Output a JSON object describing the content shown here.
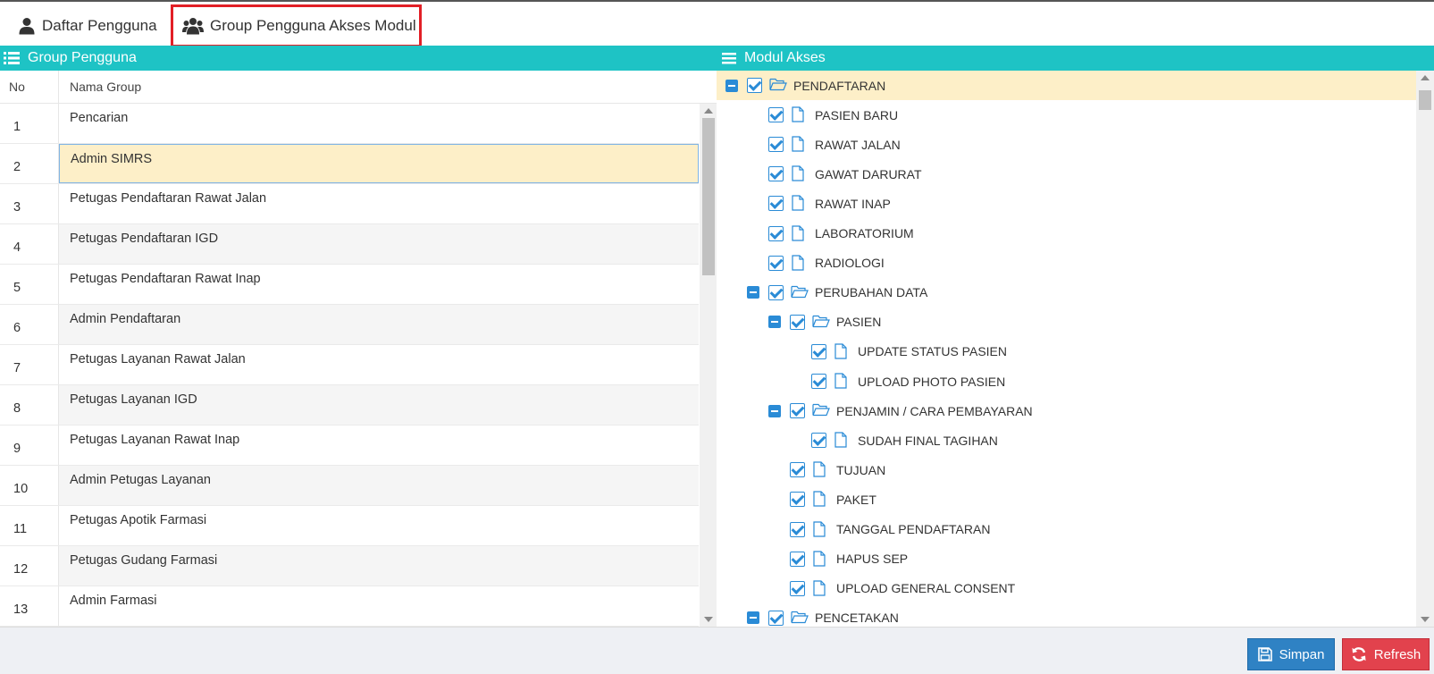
{
  "tabs": [
    {
      "label": "Daftar Pengguna",
      "icon": "user-icon"
    },
    {
      "label": "Group Pengguna Akses Modul",
      "icon": "users-icon",
      "active": true
    }
  ],
  "left_panel": {
    "title": "Group Pengguna",
    "columns": {
      "no": "No",
      "name": "Nama Group"
    },
    "selected_index": 1,
    "rows": [
      {
        "no": "1",
        "name": "Pencarian"
      },
      {
        "no": "2",
        "name": "Admin SIMRS"
      },
      {
        "no": "3",
        "name": "Petugas Pendaftaran Rawat Jalan"
      },
      {
        "no": "4",
        "name": "Petugas Pendaftaran IGD"
      },
      {
        "no": "5",
        "name": "Petugas Pendaftaran Rawat Inap"
      },
      {
        "no": "6",
        "name": "Admin Pendaftaran"
      },
      {
        "no": "7",
        "name": "Petugas Layanan Rawat Jalan"
      },
      {
        "no": "8",
        "name": "Petugas Layanan IGD"
      },
      {
        "no": "9",
        "name": "Petugas Layanan Rawat Inap"
      },
      {
        "no": "10",
        "name": "Admin Petugas Layanan"
      },
      {
        "no": "11",
        "name": "Petugas Apotik Farmasi"
      },
      {
        "no": "12",
        "name": "Petugas Gudang Farmasi"
      },
      {
        "no": "13",
        "name": "Admin Farmasi"
      }
    ]
  },
  "right_panel": {
    "title": "Modul Akses",
    "tree": [
      {
        "label": "PENDAFTARAN",
        "level": 0,
        "type": "folder",
        "checked": true,
        "highlighted": true
      },
      {
        "label": "PASIEN BARU",
        "level": 1,
        "type": "file",
        "checked": true
      },
      {
        "label": "RAWAT JALAN",
        "level": 1,
        "type": "file",
        "checked": true
      },
      {
        "label": "GAWAT DARURAT",
        "level": 1,
        "type": "file",
        "checked": true
      },
      {
        "label": "RAWAT INAP",
        "level": 1,
        "type": "file",
        "checked": true
      },
      {
        "label": "LABORATORIUM",
        "level": 1,
        "type": "file",
        "checked": true
      },
      {
        "label": "RADIOLOGI",
        "level": 1,
        "type": "file",
        "checked": true
      },
      {
        "label": "PERUBAHAN DATA",
        "level": 1,
        "type": "folder",
        "checked": true
      },
      {
        "label": "PASIEN",
        "level": 2,
        "type": "folder",
        "checked": true
      },
      {
        "label": "UPDATE STATUS PASIEN",
        "level": 3,
        "type": "file",
        "checked": true
      },
      {
        "label": "UPLOAD PHOTO PASIEN",
        "level": 3,
        "type": "file",
        "checked": true
      },
      {
        "label": "PENJAMIN / CARA PEMBAYARAN",
        "level": 2,
        "type": "folder",
        "checked": true
      },
      {
        "label": "SUDAH FINAL TAGIHAN",
        "level": 3,
        "type": "file",
        "checked": true
      },
      {
        "label": "TUJUAN",
        "level": 2,
        "type": "file",
        "checked": true
      },
      {
        "label": "PAKET",
        "level": 2,
        "type": "file",
        "checked": true
      },
      {
        "label": "TANGGAL PENDAFTARAN",
        "level": 2,
        "type": "file",
        "checked": true
      },
      {
        "label": "HAPUS SEP",
        "level": 2,
        "type": "file",
        "checked": true
      },
      {
        "label": "UPLOAD GENERAL CONSENT",
        "level": 2,
        "type": "file",
        "checked": true
      },
      {
        "label": "PENCETAKAN",
        "level": 1,
        "type": "folder",
        "checked": true
      }
    ]
  },
  "footer": {
    "save_label": "Simpan",
    "refresh_label": "Refresh"
  },
  "colors": {
    "header_bg": "#1ec3c5",
    "selected_row": "#fdefc8",
    "active_tab_border": "#e21f26",
    "save_button": "#2f82c4",
    "refresh_button": "#e2424d",
    "tree_accent": "#2a8bd6"
  }
}
